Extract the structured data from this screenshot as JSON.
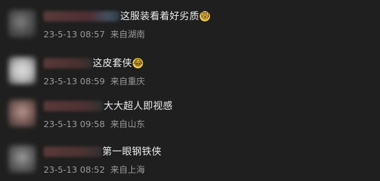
{
  "comments": [
    {
      "text": "这服装看着好劣质",
      "emoji": "😾",
      "time": "23-5-13 08:57",
      "location": "来自湖南"
    },
    {
      "text": "这皮套侠",
      "emoji": "😂",
      "time": "23-5-13 08:59",
      "location": "来自重庆"
    },
    {
      "text": "大大超人即视感",
      "emoji": "",
      "time": "23-5-13 09:58",
      "location": "来自山东"
    },
    {
      "text": "第一眼钢铁侠",
      "emoji": "",
      "time": "23-5-13 08:52",
      "location": "来自上海"
    }
  ]
}
